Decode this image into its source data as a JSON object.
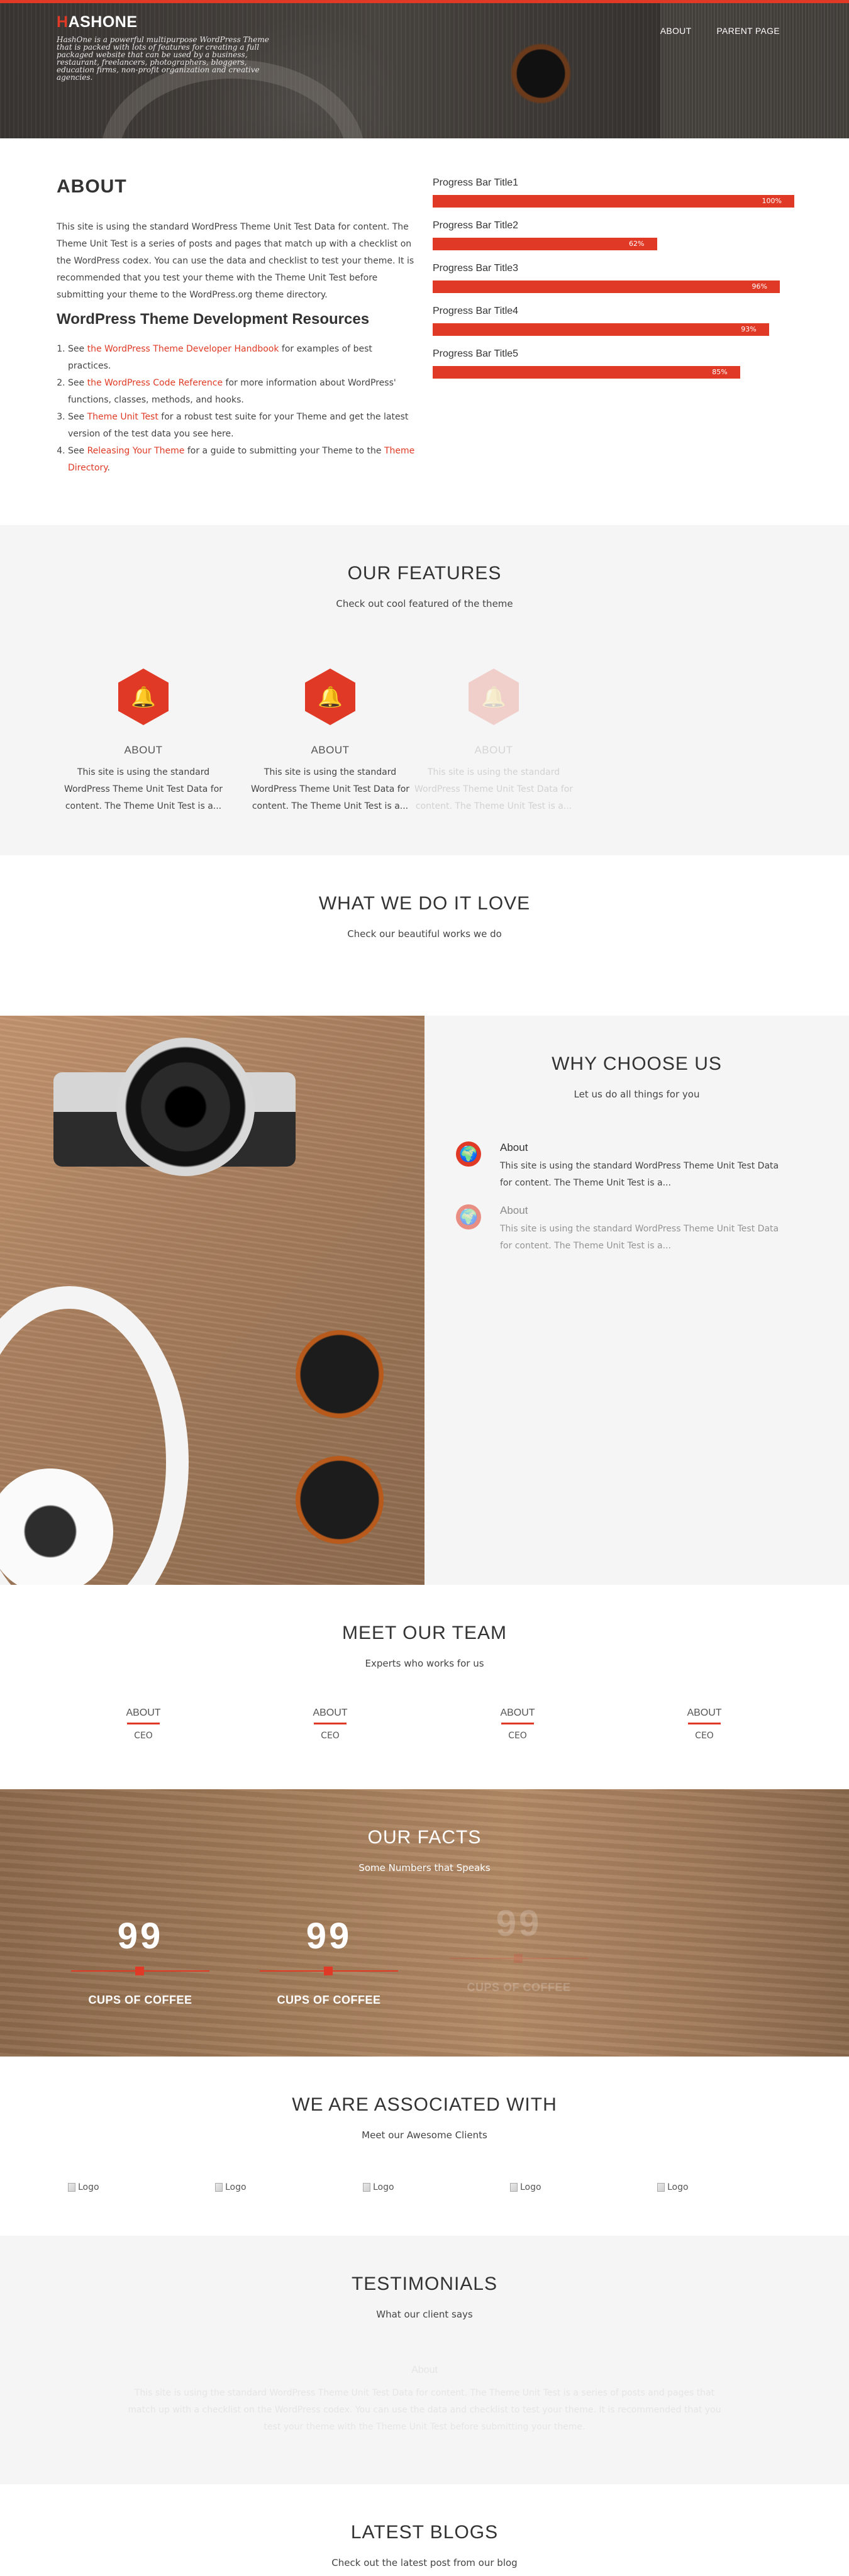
{
  "header": {
    "logo_first": "H",
    "logo_rest": "ASHONE",
    "tagline": "HashOne is a powerful multipurpose WordPress Theme that is packed with lots of features for creating a full packaged website that can be used by a business, restaurant, freelancers, photographers, bloggers, education firms, non-profit organization and creative agencies.",
    "nav": [
      "ABOUT",
      "PARENT PAGE"
    ],
    "accent_color": "#e03a26"
  },
  "about": {
    "title": "ABOUT",
    "text": "This site is using the standard WordPress Theme Unit Test Data for content. The Theme Unit Test is a series of posts and pages that match up with a checklist on the WordPress codex. You can use the data and checklist to test your theme. It is recommended that you test your theme with the Theme Unit Test before submitting your theme to the WordPress.org theme directory.",
    "resources_title": "WordPress Theme Development Resources",
    "resources": [
      {
        "pre": "See ",
        "link": "the WordPress Theme Developer Handbook",
        "post": " for examples of best practices."
      },
      {
        "pre": "See ",
        "link": "the WordPress Code Reference",
        "post": " for more information about WordPress' functions, classes, methods, and hooks."
      },
      {
        "pre": "See ",
        "link": "Theme Unit Test",
        "post": " for a robust test suite for your Theme and get the latest version of the test data you see here."
      },
      {
        "pre": "See ",
        "link": "Releasing Your Theme",
        "post": " for a guide to submitting your Theme to the ",
        "link2": "Theme Directory",
        "post2": "."
      }
    ],
    "progress_bars": [
      {
        "label": "Progress Bar Title1",
        "value": 100,
        "text": "100%"
      },
      {
        "label": "Progress Bar Title2",
        "value": 62,
        "text": "62%"
      },
      {
        "label": "Progress Bar Title3",
        "value": 96,
        "text": "96%"
      },
      {
        "label": "Progress Bar Title4",
        "value": 93,
        "text": "93%"
      },
      {
        "label": "Progress Bar Title5",
        "value": 85,
        "text": "85%"
      }
    ]
  },
  "features": {
    "title": "OUR FEATURES",
    "subtitle": "Check out cool featured of the theme",
    "items": [
      {
        "icon": "bell-icon",
        "title": "ABOUT",
        "text": "This site is using the standard WordPress Theme Unit Test Data for content. The Theme Unit Test is a..."
      },
      {
        "icon": "bell-icon",
        "title": "ABOUT",
        "text": "This site is using the standard WordPress Theme Unit Test Data for content. The Theme Unit Test is a..."
      },
      {
        "icon": "bell-icon",
        "title": "ABOUT",
        "text": "This site is using the standard WordPress Theme Unit Test Data for content. The Theme Unit Test is a..."
      }
    ]
  },
  "whatwedo": {
    "title": "WHAT WE DO IT LOVE",
    "subtitle": "Check our beautiful works we do"
  },
  "why": {
    "title": "WHY CHOOSE US",
    "subtitle": "Let us do all things for you",
    "items": [
      {
        "icon": "globe-icon",
        "title": "About",
        "text": "This site is using the standard WordPress Theme Unit Test Data for content. The Theme Unit Test is a..."
      },
      {
        "icon": "globe-icon",
        "title": "About",
        "text": "This site is using the standard WordPress Theme Unit Test Data for content. The Theme Unit Test is a..."
      }
    ]
  },
  "team": {
    "title": "MEET OUR TEAM",
    "subtitle": "Experts who works for us",
    "members": [
      {
        "name": "ABOUT",
        "role": "CEO"
      },
      {
        "name": "ABOUT",
        "role": "CEO"
      },
      {
        "name": "ABOUT",
        "role": "CEO"
      },
      {
        "name": "ABOUT",
        "role": "CEO"
      }
    ]
  },
  "facts": {
    "title": "OUR FACTS",
    "subtitle": "Some Numbers that Speaks",
    "items": [
      {
        "number": "99",
        "label": "CUPS OF COFFEE"
      },
      {
        "number": "99",
        "label": "CUPS OF COFFEE"
      },
      {
        "number": "99",
        "label": "CUPS OF COFFEE"
      }
    ]
  },
  "clients": {
    "title": "WE ARE ASSOCIATED WITH",
    "subtitle": "Meet our Awesome Clients",
    "logos": [
      "Logo",
      "Logo",
      "Logo",
      "Logo",
      "Logo"
    ]
  },
  "testimonials": {
    "title": "TESTIMONIALS",
    "subtitle": "What our client says",
    "faded_name": "About",
    "faded_text": "This site is using the standard WordPress Theme Unit Test Data for content. The Theme Unit Test is a series of posts and pages that match up with a checklist on the WordPress codex. You can use the data and checklist to test your theme. It is recommended that you test your theme with the Theme Unit Test before submitting your theme."
  },
  "blogs": {
    "title": "LATEST BLOGS",
    "subtitle": "Check out the latest post from our blog"
  }
}
